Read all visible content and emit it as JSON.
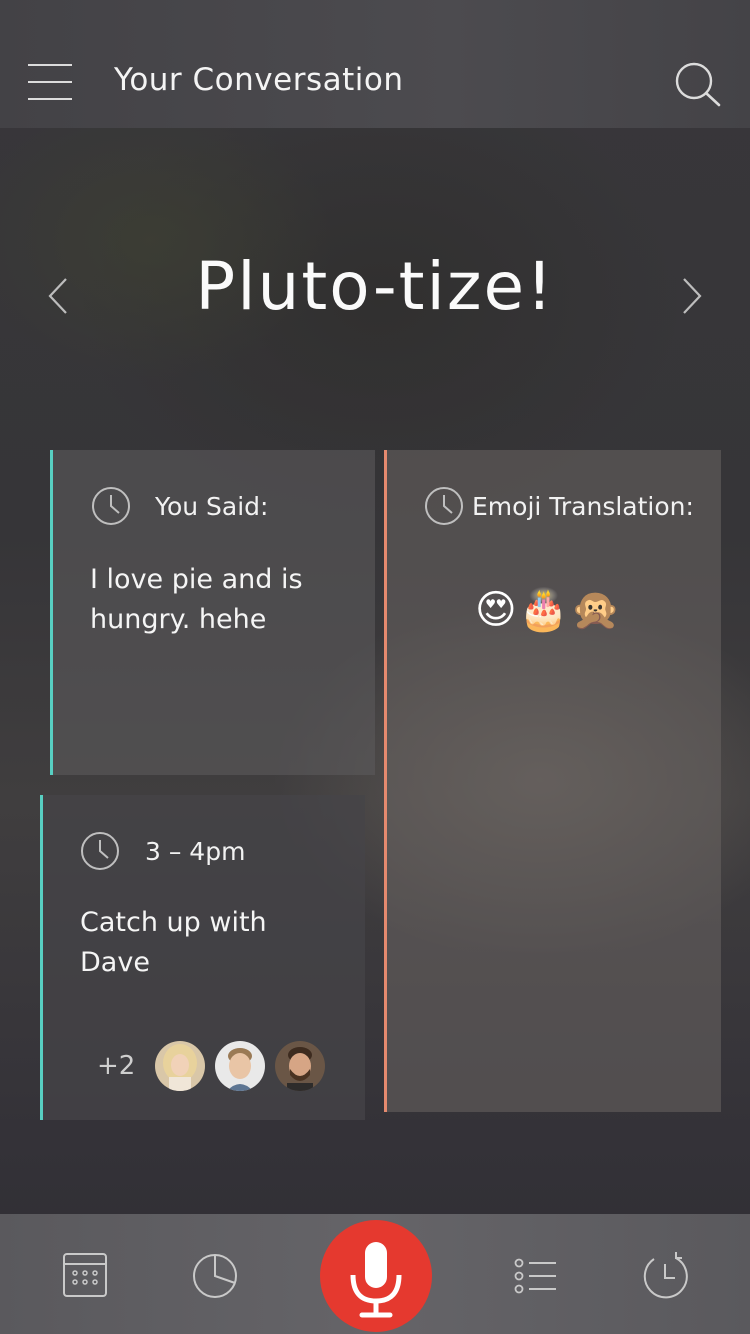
{
  "header": {
    "title": "Your Conversation",
    "menu_icon": "hamburger-menu-icon",
    "search_icon": "search-icon"
  },
  "hero": {
    "title": "Pluto-tize!",
    "prev_icon": "chevron-left-icon",
    "next_icon": "chevron-right-icon"
  },
  "cards": {
    "you_said": {
      "label": "You Said:",
      "text_line1": "I love pie and is",
      "text_line2": "hungry. hehe",
      "accent_color": "#58cfc2"
    },
    "emoji_translation": {
      "label": "Emoji Translation:",
      "emojis": "😍🎂🙊",
      "accent_color": "#e58a6f"
    },
    "event": {
      "time": "3 – 4pm",
      "title_line1": "Catch up with",
      "title_line2": "Dave",
      "extra_attendees": "+2",
      "accent_color": "#58cfc2"
    }
  },
  "bottom_nav": {
    "tabs": [
      "calendar-grid-icon",
      "pie-chart-icon",
      "microphone-icon",
      "list-icon",
      "history-icon"
    ],
    "mic_color": "#e5392f"
  }
}
